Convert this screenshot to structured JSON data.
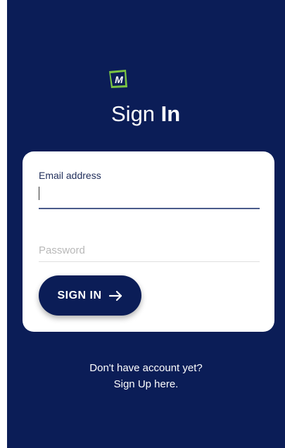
{
  "brand": {
    "logo_icon": "brand-m-logo-icon",
    "logo_text": "M",
    "accent_color": "#7bc443"
  },
  "header": {
    "title_light": "Sign",
    "title_bold": "In"
  },
  "form": {
    "email_label": "Email address",
    "email_value": "",
    "password_placeholder": "Password",
    "password_value": "",
    "submit_label": "SIGN IN",
    "submit_icon": "arrow-right-icon"
  },
  "footer": {
    "line1": "Don't have account yet?",
    "line2": "Sign Up here."
  },
  "colors": {
    "background": "#0b1d57",
    "card": "#ffffff",
    "button": "#0b1d57"
  }
}
